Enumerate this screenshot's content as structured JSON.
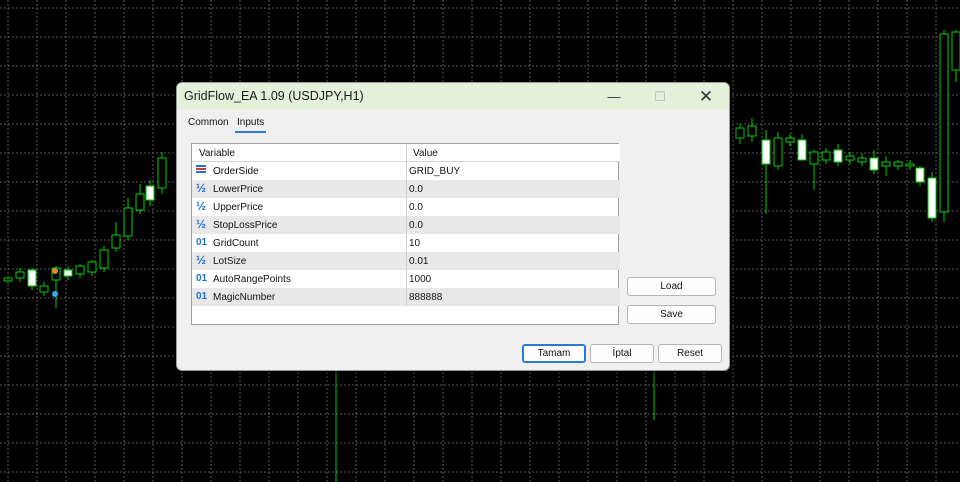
{
  "colors": {
    "chart_bg": "#000000",
    "chart_grid": "#5a5a5a",
    "candle_up": "#00d000",
    "candle_body_down": "#ffffff",
    "titlebar": "#e4f0d9",
    "accent": "#2a7ccf"
  },
  "window": {
    "title": "GridFlow_EA 1.09 (USDJPY,H1)",
    "minimize_glyph": "—",
    "maximize_glyph": "☐",
    "close_glyph": "✕"
  },
  "tabs": [
    {
      "label": "Common",
      "active": false
    },
    {
      "label": "Inputs",
      "active": true
    }
  ],
  "table": {
    "headers": {
      "variable": "Variable",
      "value": "Value"
    },
    "rows": [
      {
        "icon": "enum-icon",
        "variable": "OrderSide",
        "value": "GRID_BUY"
      },
      {
        "icon": "double-icon",
        "glyph": "½",
        "variable": "LowerPrice",
        "value": "0.0"
      },
      {
        "icon": "double-icon",
        "glyph": "½",
        "variable": "UpperPrice",
        "value": "0.0"
      },
      {
        "icon": "double-icon",
        "glyph": "½",
        "variable": "StopLossPrice",
        "value": "0.0"
      },
      {
        "icon": "integer-icon",
        "glyph": "01",
        "variable": "GridCount",
        "value": "10"
      },
      {
        "icon": "double-icon",
        "glyph": "½",
        "variable": "LotSize",
        "value": "0.01"
      },
      {
        "icon": "integer-icon",
        "glyph": "01",
        "variable": "AutoRangePoints",
        "value": "1000"
      },
      {
        "icon": "integer-icon",
        "glyph": "01",
        "variable": "MagicNumber",
        "value": "888888"
      }
    ]
  },
  "buttons": {
    "load": "Load",
    "save": "Save",
    "ok": "Tamam",
    "cancel": "İptal",
    "reset": "Reset"
  }
}
